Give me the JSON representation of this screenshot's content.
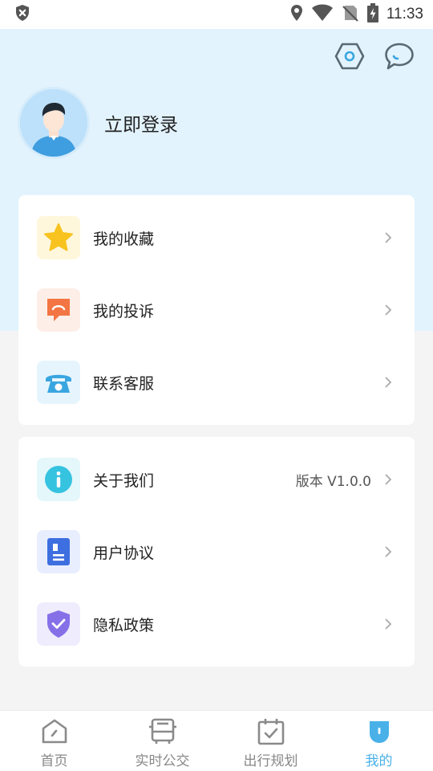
{
  "status_bar": {
    "time": "11:33",
    "icons": [
      "shield-x-icon",
      "location-icon",
      "wifi-icon",
      "no-sim-icon",
      "battery-charging-icon"
    ]
  },
  "header": {
    "icons": [
      "settings-hex-icon",
      "message-bubble-icon"
    ],
    "login_label": "立即登录"
  },
  "menu_group_1": {
    "items": [
      {
        "label": "我的收藏",
        "icon": "star-icon",
        "icon_bg": "#fff7dc",
        "icon_color": "#f8c31f"
      },
      {
        "label": "我的投诉",
        "icon": "complaint-icon",
        "icon_bg": "#fdeee8",
        "icon_color": "#f27543"
      },
      {
        "label": "联系客服",
        "icon": "phone-icon",
        "icon_bg": "#e6f5fd",
        "icon_color": "#3aa6e0"
      }
    ]
  },
  "menu_group_2": {
    "items": [
      {
        "label": "关于我们",
        "extra": "版本 V1.0.0",
        "icon": "info-icon",
        "icon_bg": "#e4f7fb",
        "icon_color": "#36c3e0"
      },
      {
        "label": "用户协议",
        "icon": "document-icon",
        "icon_bg": "#e8eefd",
        "icon_color": "#3e6fe0"
      },
      {
        "label": "隐私政策",
        "icon": "privacy-shield-icon",
        "icon_bg": "#efecfd",
        "icon_color": "#8670e8"
      }
    ]
  },
  "tabbar": {
    "active_color": "#4ab1e8",
    "tabs": [
      {
        "label": "首页",
        "icon": "home-compass-icon"
      },
      {
        "label": "实时公交",
        "icon": "bus-icon"
      },
      {
        "label": "出行规划",
        "icon": "calendar-check-icon"
      },
      {
        "label": "我的",
        "icon": "profile-badge-icon"
      }
    ]
  }
}
